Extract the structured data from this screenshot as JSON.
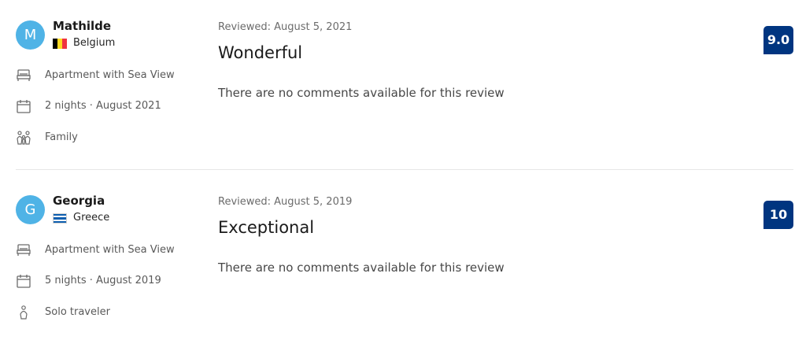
{
  "reviews": [
    {
      "avatar_letter": "M",
      "avatar_color": "#4fb3e6",
      "name": "Mathilde",
      "country": "Belgium",
      "flag_colors": [
        "#000000",
        "#fdda24",
        "#ef3340"
      ],
      "room_icon": "bed-icon",
      "room": "Apartment with Sea View",
      "stay_icon": "calendar-icon",
      "stay": "2 nights · August 2021",
      "traveler_icon": "family-icon",
      "traveler_type": "Family",
      "reviewed_date": "Reviewed: August 5, 2021",
      "title": "Wonderful",
      "comment": "There are no comments available for this review",
      "score": "9.0"
    },
    {
      "avatar_letter": "G",
      "avatar_color": "#4fb3e6",
      "name": "Georgia",
      "country": "Greece",
      "flag_colors": [
        "#0d5eaf",
        "#ffffff"
      ],
      "room_icon": "bed-icon",
      "room": "Apartment with Sea View",
      "stay_icon": "calendar-icon",
      "stay": "5 nights · August 2019",
      "traveler_icon": "solo-traveler-icon",
      "traveler_type": "Solo traveler",
      "reviewed_date": "Reviewed: August 5, 2019",
      "title": "Exceptional",
      "comment": "There are no comments available for this review",
      "score": "10"
    }
  ],
  "score_badge_color": "#003580"
}
